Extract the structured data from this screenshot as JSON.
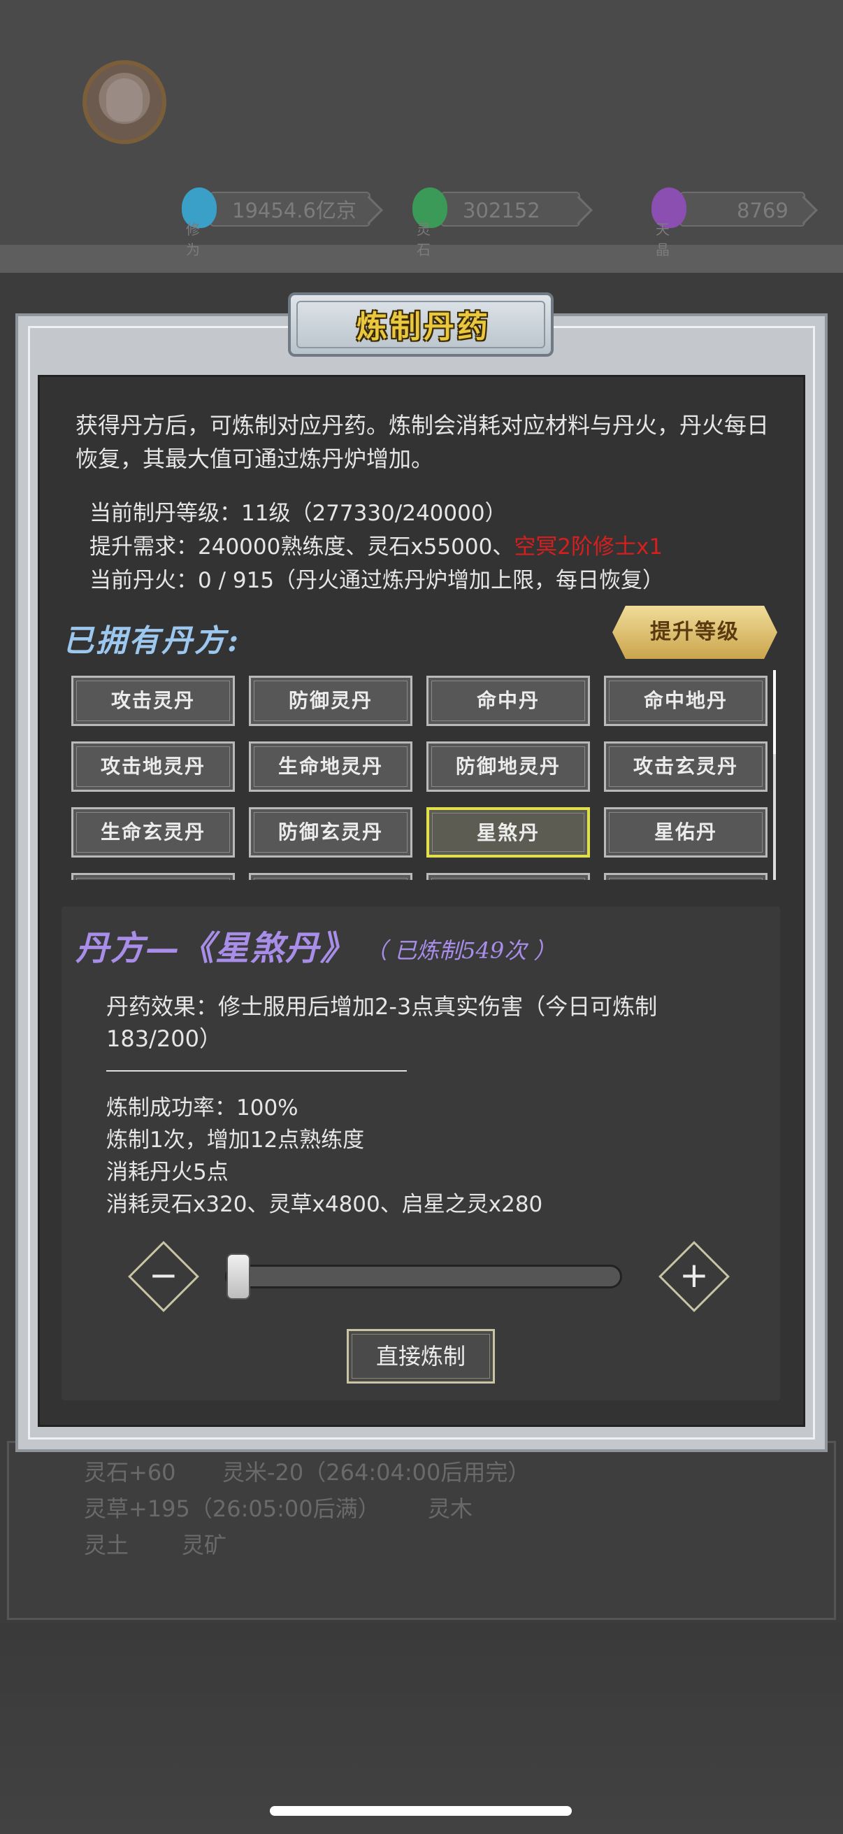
{
  "resources": [
    {
      "value": "19454.6亿京",
      "tag": "修为",
      "color": "#3aa0c8"
    },
    {
      "value": "302152",
      "tag": "灵石",
      "color": "#3c9a58"
    },
    {
      "value": "8769",
      "tag": "天晶",
      "color": "#8a4fb0"
    }
  ],
  "background_panel": {
    "line1_a": "灵石+60",
    "line1_b": "灵米-20（264:04:00后用完）",
    "line2_a": "灵草+195（26:05:00后满）",
    "line2_b": "灵木",
    "line3_a": "灵土",
    "line3_b": "灵矿"
  },
  "modal": {
    "title": "炼制丹药",
    "intro": "获得丹方后，可炼制对应丹药。炼制会消耗对应材料与丹火，丹火每日恢复，其最大值可通过炼丹炉增加。",
    "level_line": "当前制丹等级：11级（277330/240000）",
    "upgrade_req_prefix": "提升需求：240000熟练度、灵石x55000、",
    "upgrade_req_red": "空冥2阶修士x1",
    "fire_line": "当前丹火：0 / 915（丹火通过炼丹炉增加上限，每日恢复）",
    "owned_title": "已拥有丹方:",
    "upgrade_button": "提升等级",
    "recipes": [
      "攻击灵丹",
      "防御灵丹",
      "命中丹",
      "命中地丹",
      "攻击地灵丹",
      "生命地灵丹",
      "防御地灵丹",
      "攻击玄灵丹",
      "生命玄灵丹",
      "防御玄灵丹",
      "星煞丹",
      "星佑丹"
    ],
    "selected_recipe_index": 10
  },
  "detail": {
    "title": "丹方—《星煞丹》",
    "count": "（ 已炼制549次 ）",
    "effect": "丹药效果：修士服用后增加2-3点真实伤害（今日可炼制183/200）",
    "success_rate": "炼制成功率：100%",
    "proficiency": "炼制1次，增加12点熟练度",
    "fire_cost": "消耗丹火5点",
    "materials": "消耗灵石x320、灵草x4800、启星之灵x280",
    "minus_glyph": "−",
    "plus_glyph": "+",
    "slider_value": 0.0,
    "craft_button": "直接炼制"
  }
}
